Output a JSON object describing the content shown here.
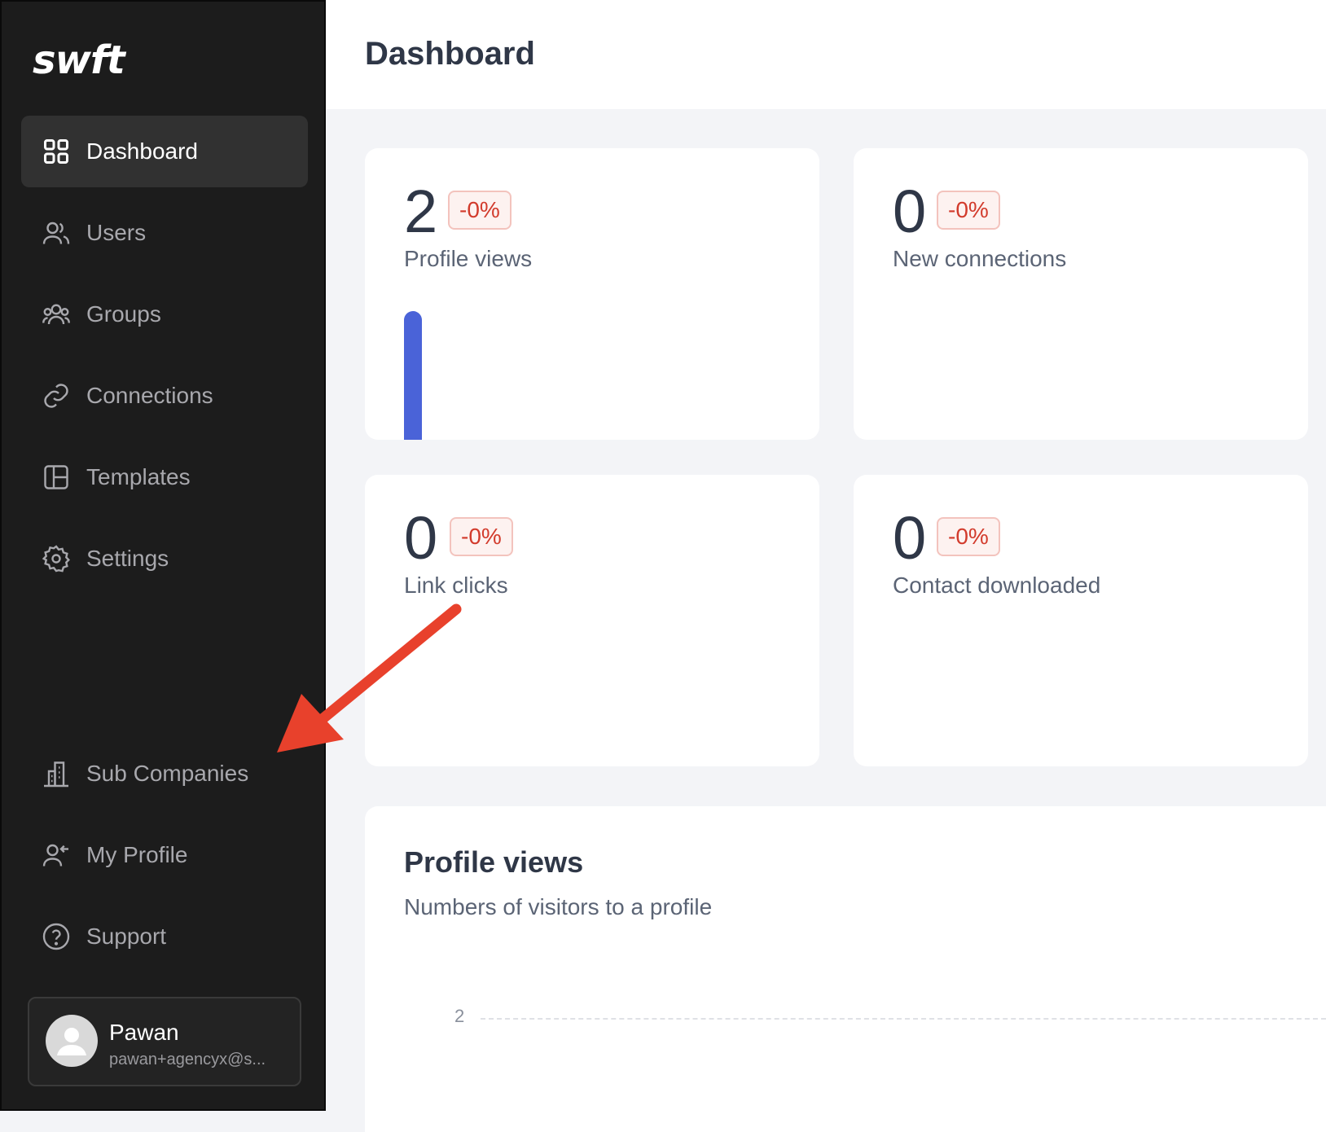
{
  "sidebar": {
    "logo": "swft",
    "nav": [
      {
        "label": "Dashboard"
      },
      {
        "label": "Users"
      },
      {
        "label": "Groups"
      },
      {
        "label": "Connections"
      },
      {
        "label": "Templates"
      },
      {
        "label": "Settings"
      }
    ],
    "bottom_nav": [
      {
        "label": "Sub Companies"
      },
      {
        "label": "My Profile"
      },
      {
        "label": "Support"
      }
    ],
    "user": {
      "name": "Pawan",
      "email": "pawan+agencyx@s..."
    }
  },
  "header": {
    "title": "Dashboard"
  },
  "stats": [
    {
      "value": "2",
      "change": "-0%",
      "label": "Profile views",
      "bar_fraction": 1.0
    },
    {
      "value": "0",
      "change": "-0%",
      "label": "New connections"
    },
    {
      "value": "0",
      "change": "-0%",
      "label": "Link clicks"
    },
    {
      "value": "0",
      "change": "-0%",
      "label": "Contact downloaded"
    }
  ],
  "chart_panel": {
    "title": "Profile views",
    "subtitle": "Numbers of visitors to a profile",
    "y_tick": "2"
  },
  "colors": {
    "sidebar_bg": "#1c1c1c",
    "active_nav_bg": "#313131",
    "badge_text": "#d23b2c",
    "bar": "#4a63d8",
    "annotation_arrow": "#e8412c"
  }
}
